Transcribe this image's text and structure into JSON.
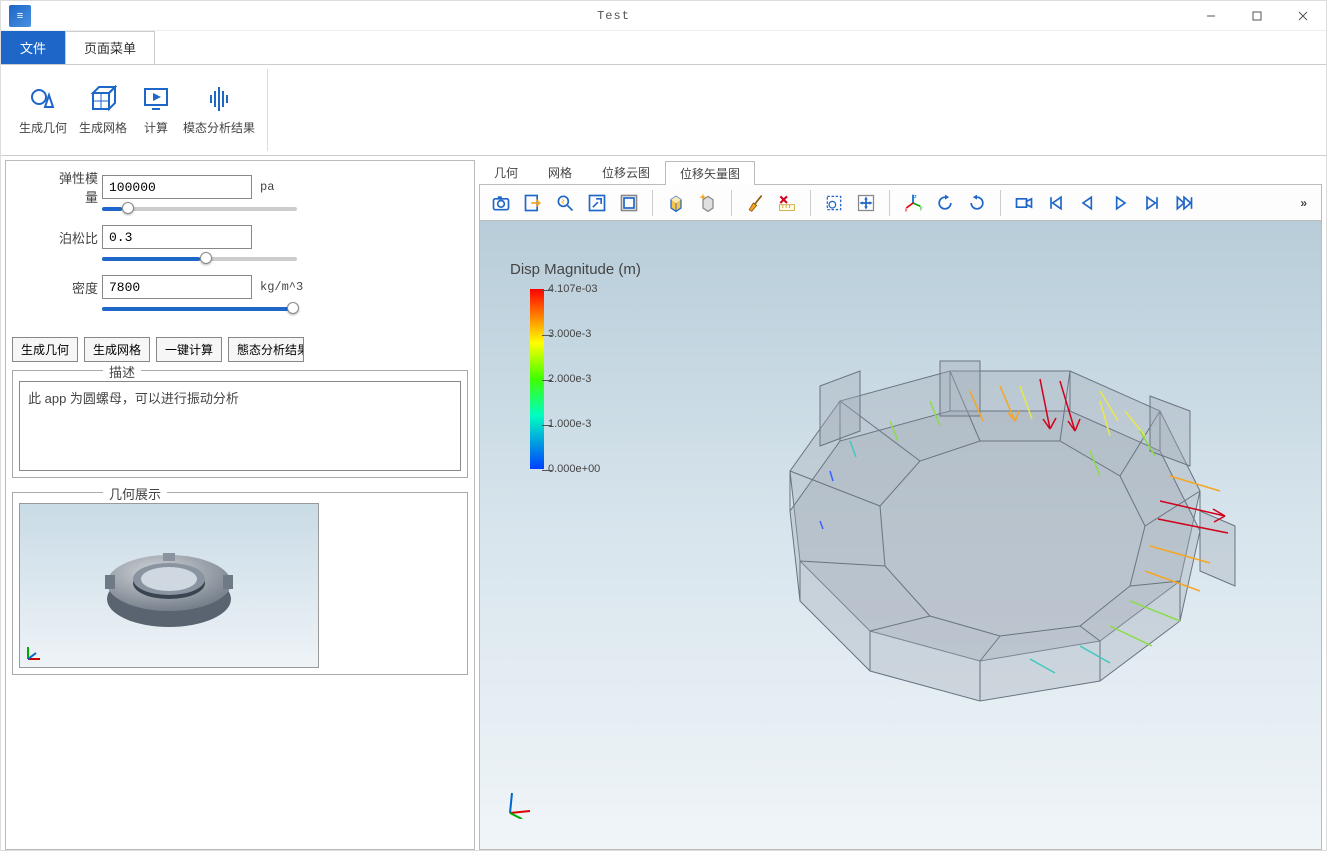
{
  "window": {
    "title": "Test",
    "app_icon_glyph": "≡"
  },
  "menu_tabs": {
    "file": "文件",
    "page_menu": "页面菜单"
  },
  "ribbon": {
    "gen_geom": "生成几何",
    "gen_mesh": "生成网格",
    "compute": "计算",
    "modal_result": "模态分析结果"
  },
  "params": {
    "elastic_label": "弹性模量",
    "elastic_value": "100000",
    "elastic_unit": "pa",
    "poisson_label": "泊松比",
    "poisson_value": "0.3",
    "density_label": "密度",
    "density_value": "7800",
    "density_unit": "kg/m^3"
  },
  "buttons": {
    "gen_geom": "生成几何",
    "gen_mesh": "生成网格",
    "one_click": "一键计算",
    "modal_result": "態态分析结果"
  },
  "desc": {
    "legend": "描述",
    "text": "此 app 为圆螺母，可以进行振动分析"
  },
  "geom_preview": {
    "legend": "几何展示"
  },
  "content_tabs": {
    "geom": "几何",
    "mesh": "网格",
    "disp_cloud": "位移云图",
    "disp_vector": "位移矢量图",
    "active": "disp_vector"
  },
  "viewer": {
    "legend_title": "Disp Magnitude (m)",
    "colorbar_ticks": [
      {
        "label": "4.107e-03",
        "pos": 0
      },
      {
        "label": "3.000e-3",
        "pos": 45
      },
      {
        "label": "2.000e-3",
        "pos": 90
      },
      {
        "label": "1.000e-3",
        "pos": 135
      },
      {
        "label": "0.000e+00",
        "pos": 180
      }
    ]
  },
  "more_glyph": "»"
}
